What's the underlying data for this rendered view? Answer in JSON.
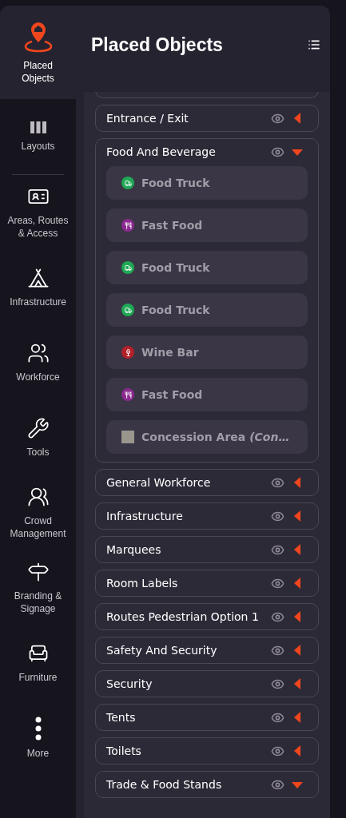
{
  "sidebar": {
    "items": [
      {
        "kind": "placed",
        "label": "Placed Objects",
        "selected": true
      },
      {
        "kind": "layouts",
        "label": "Layouts",
        "selected": false
      },
      {
        "kind": "areas",
        "label": "Areas, Routes & Access",
        "selected": false
      },
      {
        "kind": "infrastructure",
        "label": "Infrastructure",
        "selected": false
      },
      {
        "kind": "workforce",
        "label": "Workforce",
        "selected": false
      },
      {
        "kind": "tools",
        "label": "Tools",
        "selected": false
      },
      {
        "kind": "crowd",
        "label": "Crowd Management",
        "selected": false
      },
      {
        "kind": "branding",
        "label": "Branding & Signage",
        "selected": false
      },
      {
        "kind": "furniture",
        "label": "Furniture",
        "selected": false
      },
      {
        "kind": "more",
        "label": "More",
        "selected": false
      }
    ]
  },
  "panel": {
    "title": "Placed Objects",
    "groups": [
      {
        "name": "Entrance / Exit",
        "expanded": false
      },
      {
        "name": "Food And Beverage",
        "expanded": true,
        "children": [
          {
            "kind": "truck",
            "name": "Food Truck",
            "color": "#1fa855"
          },
          {
            "kind": "fastfood",
            "name": "Fast Food",
            "color": "#8a2a8f"
          },
          {
            "kind": "truck",
            "name": "Food Truck",
            "color": "#1fa855"
          },
          {
            "kind": "truck",
            "name": "Food Truck",
            "color": "#1fa855"
          },
          {
            "kind": "wine",
            "name": "Wine Bar",
            "color": "#b3202a"
          },
          {
            "kind": "fastfood",
            "name": "Fast Food",
            "color": "#8a2a8f"
          },
          {
            "kind": "area",
            "name": "Concession Area *(Con…*",
            "color": "#9a968e"
          }
        ]
      },
      {
        "name": "General Workforce",
        "expanded": false
      },
      {
        "name": "Infrastructure",
        "expanded": false
      },
      {
        "name": "Marquees",
        "expanded": false
      },
      {
        "name": "Room Labels",
        "expanded": false
      },
      {
        "name": "Routes Pedestrian Option 1",
        "expanded": false
      },
      {
        "name": "Safety And Security",
        "expanded": false
      },
      {
        "name": "Security",
        "expanded": false
      },
      {
        "name": "Tents",
        "expanded": false
      },
      {
        "name": "Toilets",
        "expanded": false
      },
      {
        "name": "Trade & Food Stands",
        "expanded": true
      }
    ]
  }
}
